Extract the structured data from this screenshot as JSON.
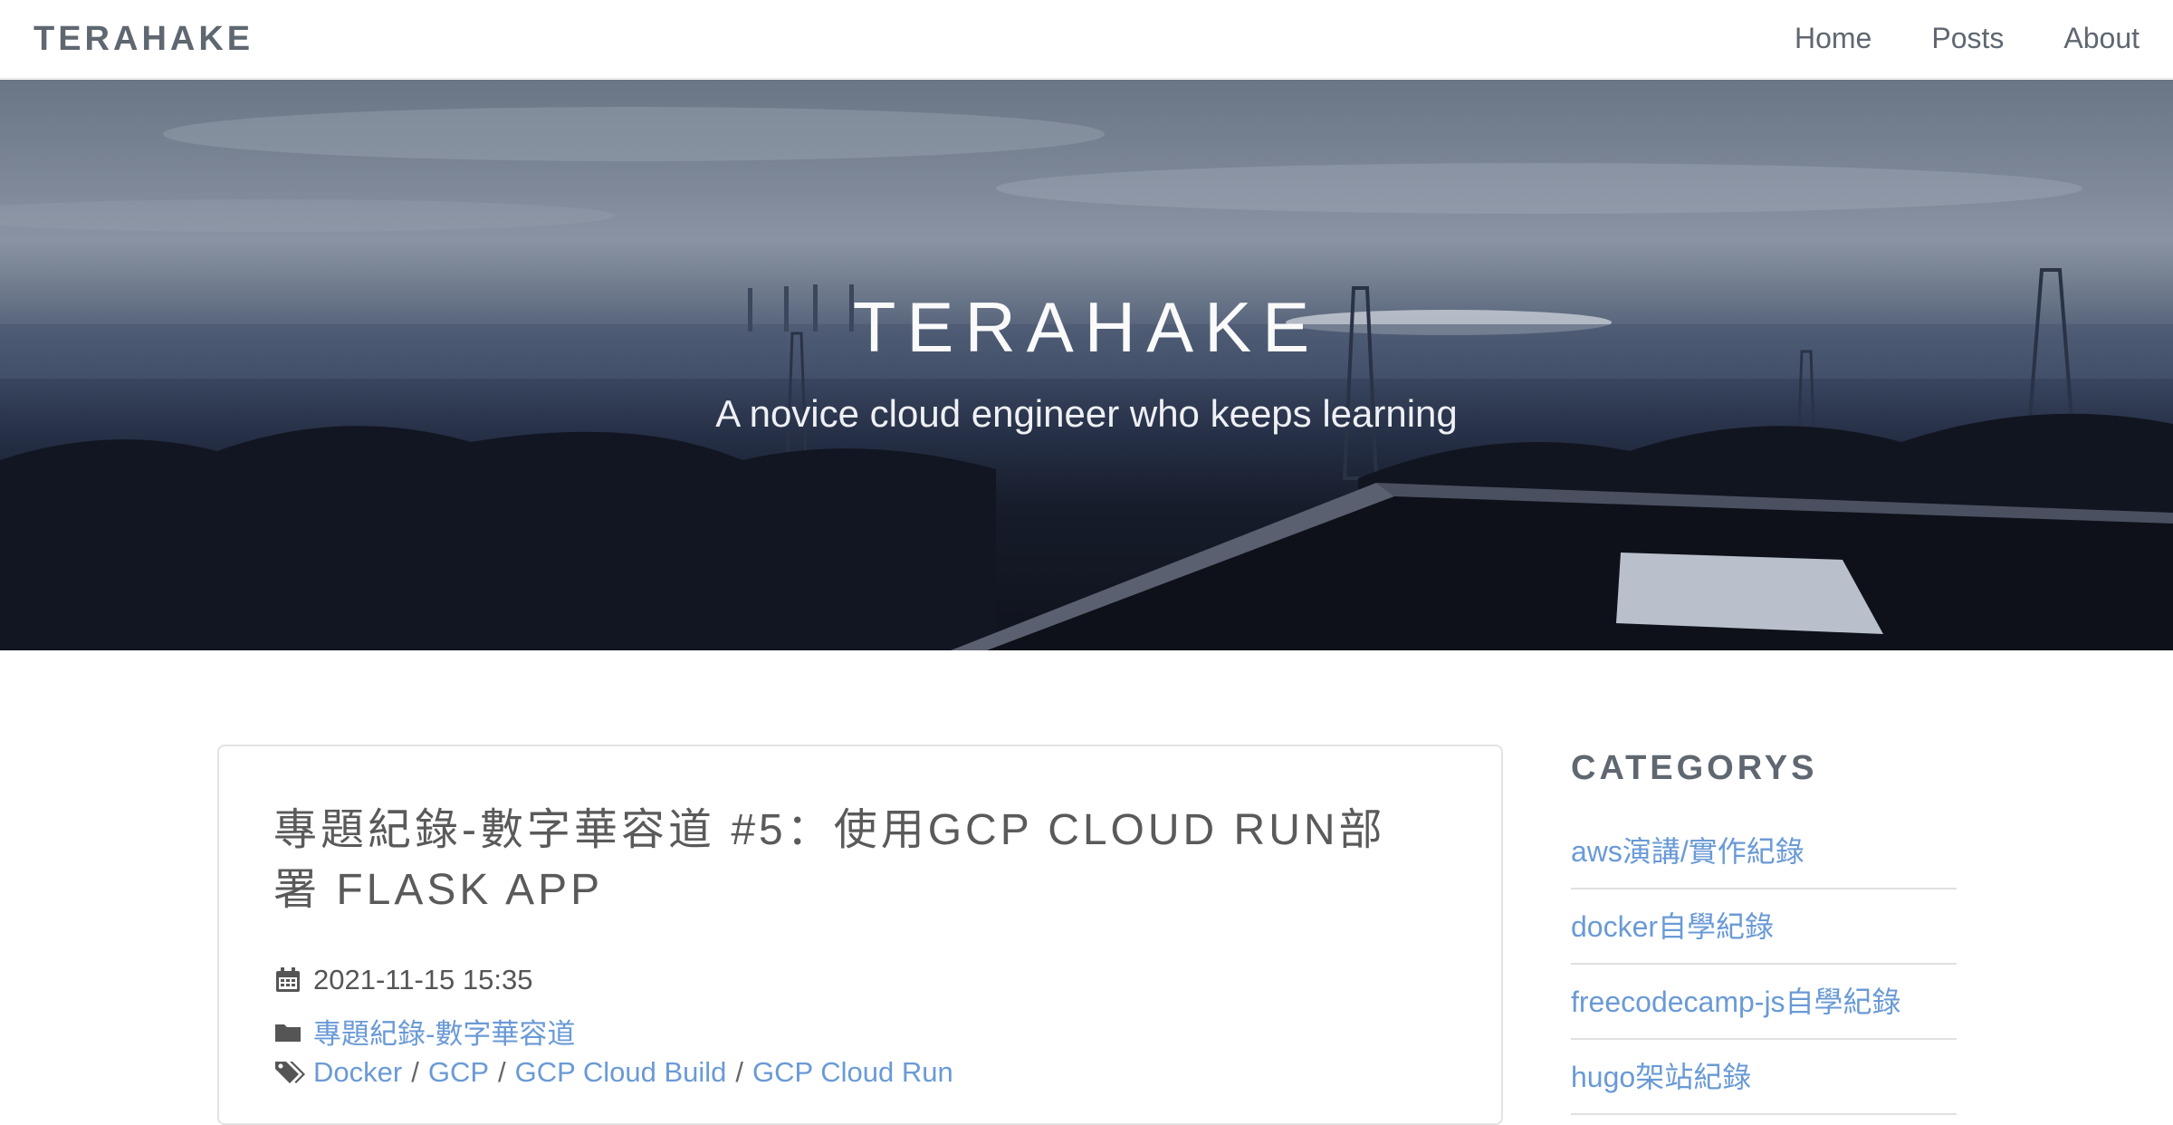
{
  "navbar": {
    "brand": "TERAHAKE",
    "links": [
      "Home",
      "Posts",
      "About"
    ]
  },
  "hero": {
    "title": "TERAHAKE",
    "subtitle": "A novice cloud engineer who keeps learning"
  },
  "post": {
    "title": "專題紀錄-數字華容道 #5：使用GCP CLOUD RUN部署 FLASK APP",
    "date": "2021-11-15 15:35",
    "category": "專題紀錄-數字華容道",
    "tags": [
      "Docker",
      "GCP",
      "GCP Cloud Build",
      "GCP Cloud Run"
    ],
    "tag_separator": "/"
  },
  "sidebar": {
    "heading": "CATEGORYS",
    "categories": [
      "aws演講/實作紀錄",
      "docker自學紀錄",
      "freecodecamp-js自學紀錄",
      "hugo架站紀錄"
    ]
  },
  "colors": {
    "link": "#6a9ad6",
    "heading_text": "#5f6770",
    "hero_text": "#fafafa"
  },
  "icons": {
    "date": "calendar-icon",
    "category": "folder-icon",
    "tags": "tags-icon"
  }
}
